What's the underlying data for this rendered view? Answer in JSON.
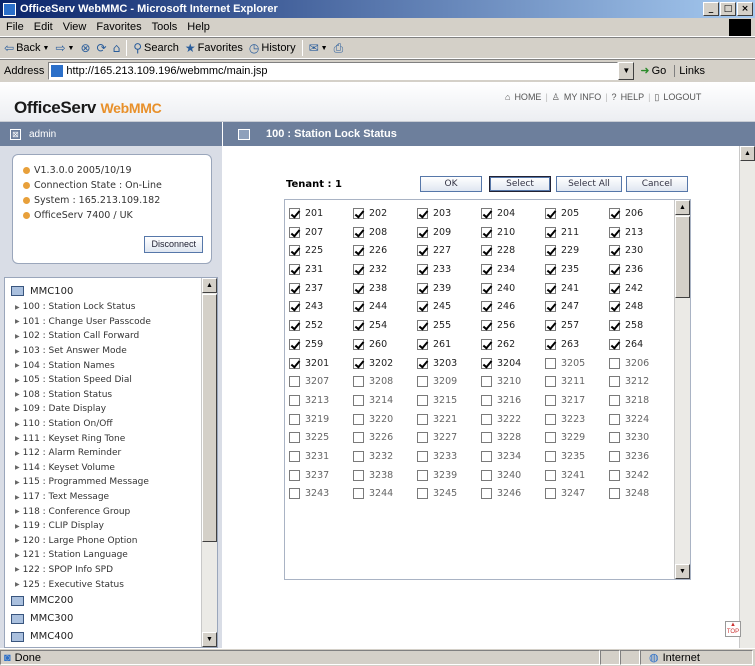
{
  "window": {
    "title": "OfficeServ WebMMC - Microsoft Internet Explorer",
    "buttons": [
      "_",
      "□",
      "×"
    ]
  },
  "menubar": [
    "File",
    "Edit",
    "View",
    "Favorites",
    "Tools",
    "Help"
  ],
  "toolbar": {
    "back": "Back",
    "search": "Search",
    "favorites": "Favorites",
    "history": "History"
  },
  "addressbar": {
    "label": "Address",
    "url": "http://165.213.109.196/webmmc/main.jsp",
    "go": "Go",
    "links": "Links"
  },
  "header": {
    "logo_main": "OfficeServ ",
    "logo_accent": "WebMMC",
    "nav": [
      "HOME",
      "MY INFO",
      "HELP",
      "LOGOUT"
    ]
  },
  "user": {
    "name": "admin"
  },
  "page": {
    "title": "100 : Station Lock Status"
  },
  "info": {
    "lines": [
      "V1.3.0.0 2005/10/19",
      "Connection State : On-Line",
      "System : 165.213.109.182",
      "OfficeServ 7400 / UK"
    ],
    "disconnect": "Disconnect"
  },
  "menu": {
    "groups": [
      {
        "label": "MMC100",
        "items": [
          "100 : Station Lock Status",
          "101 : Change User Passcode",
          "102 : Station Call Forward",
          "103 : Set Answer Mode",
          "104 : Station Names",
          "105 : Station Speed Dial",
          "108 : Station Status",
          "109 : Date Display",
          "110 : Station On/Off",
          "111 : Keyset Ring Tone",
          "112 : Alarm Reminder",
          "114 : Keyset Volume",
          "115 : Programmed Message",
          "117 : Text Message",
          "118 : Conference Group",
          "119 : CLIP Display",
          "120 : Large Phone Option",
          "121 : Station Language",
          "122 : SPOP Info SPD",
          "125 : Executive Status"
        ]
      },
      {
        "label": "MMC200",
        "items": []
      },
      {
        "label": "MMC300",
        "items": []
      },
      {
        "label": "MMC400",
        "items": []
      }
    ]
  },
  "form": {
    "tenant": "Tenant : 1",
    "buttons": [
      "OK",
      "Select",
      "Select All",
      "Cancel"
    ],
    "stations": [
      {
        "n": "201",
        "c": true
      },
      {
        "n": "202",
        "c": true
      },
      {
        "n": "203",
        "c": true
      },
      {
        "n": "204",
        "c": true
      },
      {
        "n": "205",
        "c": true
      },
      {
        "n": "206",
        "c": true
      },
      {
        "n": "207",
        "c": true
      },
      {
        "n": "208",
        "c": true
      },
      {
        "n": "209",
        "c": true
      },
      {
        "n": "210",
        "c": true
      },
      {
        "n": "211",
        "c": true
      },
      {
        "n": "213",
        "c": true
      },
      {
        "n": "225",
        "c": true
      },
      {
        "n": "226",
        "c": true
      },
      {
        "n": "227",
        "c": true
      },
      {
        "n": "228",
        "c": true
      },
      {
        "n": "229",
        "c": true
      },
      {
        "n": "230",
        "c": true
      },
      {
        "n": "231",
        "c": true
      },
      {
        "n": "232",
        "c": true
      },
      {
        "n": "233",
        "c": true
      },
      {
        "n": "234",
        "c": true
      },
      {
        "n": "235",
        "c": true
      },
      {
        "n": "236",
        "c": true
      },
      {
        "n": "237",
        "c": true
      },
      {
        "n": "238",
        "c": true
      },
      {
        "n": "239",
        "c": true
      },
      {
        "n": "240",
        "c": true
      },
      {
        "n": "241",
        "c": true
      },
      {
        "n": "242",
        "c": true
      },
      {
        "n": "243",
        "c": true
      },
      {
        "n": "244",
        "c": true
      },
      {
        "n": "245",
        "c": true
      },
      {
        "n": "246",
        "c": true
      },
      {
        "n": "247",
        "c": true
      },
      {
        "n": "248",
        "c": true
      },
      {
        "n": "252",
        "c": true
      },
      {
        "n": "254",
        "c": true
      },
      {
        "n": "255",
        "c": true
      },
      {
        "n": "256",
        "c": true
      },
      {
        "n": "257",
        "c": true
      },
      {
        "n": "258",
        "c": true
      },
      {
        "n": "259",
        "c": true
      },
      {
        "n": "260",
        "c": true
      },
      {
        "n": "261",
        "c": true
      },
      {
        "n": "262",
        "c": true
      },
      {
        "n": "263",
        "c": true
      },
      {
        "n": "264",
        "c": true
      },
      {
        "n": "3201",
        "c": true
      },
      {
        "n": "3202",
        "c": true
      },
      {
        "n": "3203",
        "c": true
      },
      {
        "n": "3204",
        "c": true
      },
      {
        "n": "3205",
        "c": false
      },
      {
        "n": "3206",
        "c": false
      },
      {
        "n": "3207",
        "c": false
      },
      {
        "n": "3208",
        "c": false
      },
      {
        "n": "3209",
        "c": false
      },
      {
        "n": "3210",
        "c": false
      },
      {
        "n": "3211",
        "c": false
      },
      {
        "n": "3212",
        "c": false
      },
      {
        "n": "3213",
        "c": false
      },
      {
        "n": "3214",
        "c": false
      },
      {
        "n": "3215",
        "c": false
      },
      {
        "n": "3216",
        "c": false
      },
      {
        "n": "3217",
        "c": false
      },
      {
        "n": "3218",
        "c": false
      },
      {
        "n": "3219",
        "c": false
      },
      {
        "n": "3220",
        "c": false
      },
      {
        "n": "3221",
        "c": false
      },
      {
        "n": "3222",
        "c": false
      },
      {
        "n": "3223",
        "c": false
      },
      {
        "n": "3224",
        "c": false
      },
      {
        "n": "3225",
        "c": false
      },
      {
        "n": "3226",
        "c": false
      },
      {
        "n": "3227",
        "c": false
      },
      {
        "n": "3228",
        "c": false
      },
      {
        "n": "3229",
        "c": false
      },
      {
        "n": "3230",
        "c": false
      },
      {
        "n": "3231",
        "c": false
      },
      {
        "n": "3232",
        "c": false
      },
      {
        "n": "3233",
        "c": false
      },
      {
        "n": "3234",
        "c": false
      },
      {
        "n": "3235",
        "c": false
      },
      {
        "n": "3236",
        "c": false
      },
      {
        "n": "3237",
        "c": false
      },
      {
        "n": "3238",
        "c": false
      },
      {
        "n": "3239",
        "c": false
      },
      {
        "n": "3240",
        "c": false
      },
      {
        "n": "3241",
        "c": false
      },
      {
        "n": "3242",
        "c": false
      },
      {
        "n": "3243",
        "c": false
      },
      {
        "n": "3244",
        "c": false
      },
      {
        "n": "3245",
        "c": false
      },
      {
        "n": "3246",
        "c": false
      },
      {
        "n": "3247",
        "c": false
      },
      {
        "n": "3248",
        "c": false
      }
    ]
  },
  "statusbar": {
    "left": "Done",
    "zone": "Internet"
  },
  "colors": {
    "accent": "#e8902a",
    "bar": "#6d7f9c",
    "sidebar": "#d9dde6"
  }
}
